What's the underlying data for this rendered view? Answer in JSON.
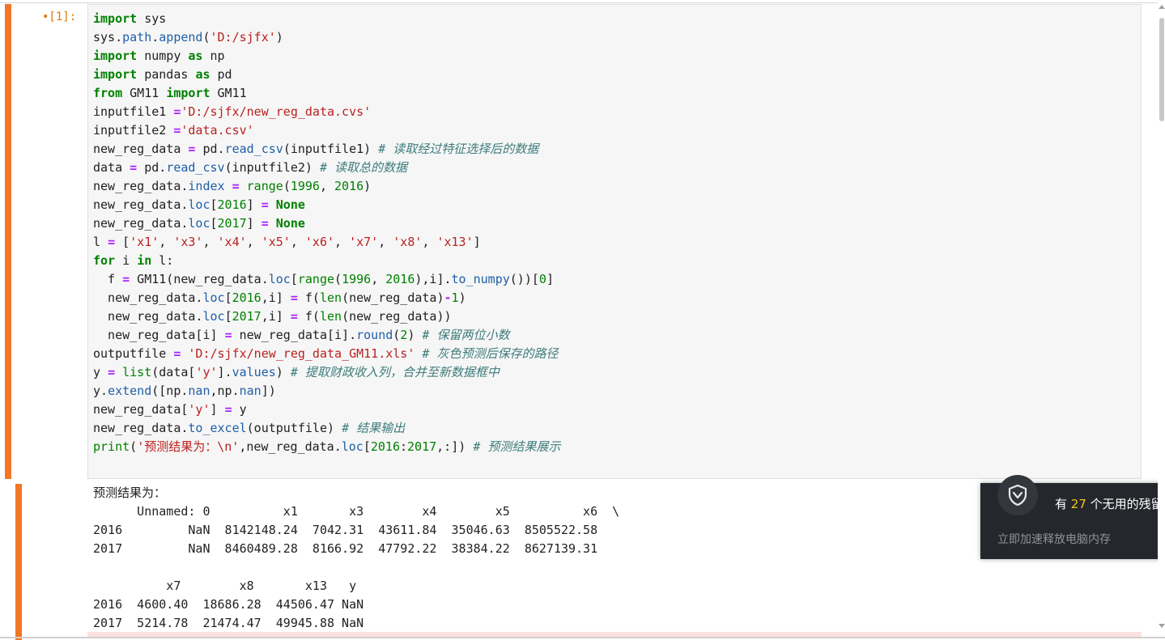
{
  "cell": {
    "prompt": "•[1]:"
  },
  "code_lines": [
    [
      [
        "kw",
        "import"
      ],
      [
        "",
        "  sys"
      ]
    ],
    [
      [
        "",
        "sys."
      ],
      [
        "attr",
        "path"
      ],
      [
        "",
        "."
      ],
      [
        "attr",
        "append"
      ],
      [
        "",
        "("
      ],
      [
        "str",
        "'D:/sjfx'"
      ],
      [
        "",
        ")"
      ]
    ],
    [
      [
        "kw",
        "import"
      ],
      [
        "",
        "  numpy "
      ],
      [
        "kw",
        "as"
      ],
      [
        "",
        "  np"
      ]
    ],
    [
      [
        "kw",
        "import"
      ],
      [
        "",
        "  pandas "
      ],
      [
        "kw",
        "as"
      ],
      [
        "",
        "  pd"
      ]
    ],
    [
      [
        "kw",
        "from"
      ],
      [
        "",
        "  GM11 "
      ],
      [
        "kw",
        "import"
      ],
      [
        "",
        "  GM11"
      ]
    ],
    [
      [
        "",
        "inputfile1 "
      ],
      [
        "op",
        "="
      ],
      [
        "str",
        "'D:/sjfx/new_reg_data.cvs'"
      ]
    ],
    [
      [
        "",
        "inputfile2 "
      ],
      [
        "op",
        "="
      ],
      [
        "str",
        "'data.csv'"
      ]
    ],
    [
      [
        "",
        "new_reg_data "
      ],
      [
        "op",
        "="
      ],
      [
        "",
        " pd."
      ],
      [
        "attr",
        "read_csv"
      ],
      [
        "",
        "(inputfile1)  "
      ],
      [
        "cm",
        "# 读取经过特征选择后的数据"
      ]
    ],
    [
      [
        "",
        "data "
      ],
      [
        "op",
        "="
      ],
      [
        "",
        " pd."
      ],
      [
        "attr",
        "read_csv"
      ],
      [
        "",
        "(inputfile2)  "
      ],
      [
        "cm",
        "# 读取总的数据"
      ]
    ],
    [
      [
        "",
        "new_reg_data."
      ],
      [
        "attr",
        "index"
      ],
      [
        "",
        " "
      ],
      [
        "op",
        "="
      ],
      [
        "",
        " "
      ],
      [
        "bi",
        "range"
      ],
      [
        "",
        "("
      ],
      [
        "num",
        "1996"
      ],
      [
        "",
        ", "
      ],
      [
        "num",
        "2016"
      ],
      [
        "",
        ")"
      ]
    ],
    [
      [
        "",
        "new_reg_data."
      ],
      [
        "attr",
        "loc"
      ],
      [
        "",
        "["
      ],
      [
        "num",
        "2016"
      ],
      [
        "",
        "] "
      ],
      [
        "op",
        "="
      ],
      [
        "",
        " "
      ],
      [
        "kw",
        "None"
      ]
    ],
    [
      [
        "",
        "new_reg_data."
      ],
      [
        "attr",
        "loc"
      ],
      [
        "",
        "["
      ],
      [
        "num",
        "2017"
      ],
      [
        "",
        "] "
      ],
      [
        "op",
        "="
      ],
      [
        "",
        " "
      ],
      [
        "kw",
        "None"
      ]
    ],
    [
      [
        "",
        "l "
      ],
      [
        "op",
        "="
      ],
      [
        "",
        " ["
      ],
      [
        "str",
        "'x1'"
      ],
      [
        "",
        ", "
      ],
      [
        "str",
        "'x3'"
      ],
      [
        "",
        ", "
      ],
      [
        "str",
        "'x4'"
      ],
      [
        "",
        ", "
      ],
      [
        "str",
        "'x5'"
      ],
      [
        "",
        ", "
      ],
      [
        "str",
        "'x6'"
      ],
      [
        "",
        ", "
      ],
      [
        "str",
        "'x7'"
      ],
      [
        "",
        ", "
      ],
      [
        "str",
        "'x8'"
      ],
      [
        "",
        ", "
      ],
      [
        "str",
        "'x13'"
      ],
      [
        "",
        "]"
      ]
    ],
    [
      [
        "kw",
        "for"
      ],
      [
        "",
        " i "
      ],
      [
        "kw",
        "in"
      ],
      [
        "",
        " l:"
      ]
    ],
    [
      [
        "",
        "    f "
      ],
      [
        "op",
        "="
      ],
      [
        "",
        " GM11(new_reg_data."
      ],
      [
        "attr",
        "loc"
      ],
      [
        "",
        "["
      ],
      [
        "bi",
        "range"
      ],
      [
        "",
        "("
      ],
      [
        "num",
        "1996"
      ],
      [
        "",
        ", "
      ],
      [
        "num",
        "2016"
      ],
      [
        "",
        "),i]."
      ],
      [
        "attr",
        "to_numpy"
      ],
      [
        "",
        "())["
      ],
      [
        "num",
        "0"
      ],
      [
        "",
        "]"
      ]
    ],
    [
      [
        "",
        "    new_reg_data."
      ],
      [
        "attr",
        "loc"
      ],
      [
        "",
        "["
      ],
      [
        "num",
        "2016"
      ],
      [
        "",
        ",i] "
      ],
      [
        "op",
        "="
      ],
      [
        "",
        " f("
      ],
      [
        "bi",
        "len"
      ],
      [
        "",
        "(new_reg_data)"
      ],
      [
        "op",
        "-"
      ],
      [
        "num",
        "1"
      ],
      [
        "",
        ")"
      ]
    ],
    [
      [
        "",
        "    new_reg_data."
      ],
      [
        "attr",
        "loc"
      ],
      [
        "",
        "["
      ],
      [
        "num",
        "2017"
      ],
      [
        "",
        ",i] "
      ],
      [
        "op",
        "="
      ],
      [
        "",
        " f("
      ],
      [
        "bi",
        "len"
      ],
      [
        "",
        "(new_reg_data))"
      ]
    ],
    [
      [
        "",
        "    new_reg_data[i] "
      ],
      [
        "op",
        "="
      ],
      [
        "",
        " new_reg_data[i]."
      ],
      [
        "attr",
        "round"
      ],
      [
        "",
        "("
      ],
      [
        "num",
        "2"
      ],
      [
        "",
        ")  "
      ],
      [
        "cm",
        "# 保留两位小数"
      ]
    ],
    [
      [
        "",
        "outputfile "
      ],
      [
        "op",
        "="
      ],
      [
        "",
        " "
      ],
      [
        "str",
        "'D:/sjfx/new_reg_data_GM11.xls'"
      ],
      [
        "",
        "  "
      ],
      [
        "cm",
        "# 灰色预测后保存的路径"
      ]
    ],
    [
      [
        "",
        "y "
      ],
      [
        "op",
        "="
      ],
      [
        "",
        " "
      ],
      [
        "bi",
        "list"
      ],
      [
        "",
        "(data["
      ],
      [
        "str",
        "'y'"
      ],
      [
        "",
        "]."
      ],
      [
        "attr",
        "values"
      ],
      [
        "",
        ")  "
      ],
      [
        "cm",
        "# 提取财政收入列，合并至新数据框中"
      ]
    ],
    [
      [
        "",
        "y."
      ],
      [
        "attr",
        "extend"
      ],
      [
        "",
        "([np."
      ],
      [
        "attr",
        "nan"
      ],
      [
        "",
        ",np."
      ],
      [
        "attr",
        "nan"
      ],
      [
        "",
        "])"
      ]
    ],
    [
      [
        "",
        "new_reg_data["
      ],
      [
        "str",
        "'y'"
      ],
      [
        "",
        "] "
      ],
      [
        "op",
        "="
      ],
      [
        "",
        " y"
      ]
    ],
    [
      [
        "",
        "new_reg_data."
      ],
      [
        "attr",
        "to_excel"
      ],
      [
        "",
        "(outputfile)  "
      ],
      [
        "cm",
        "# 结果输出"
      ]
    ],
    [
      [
        "bi",
        "print"
      ],
      [
        "",
        "("
      ],
      [
        "str",
        "'预测结果为：\\n'"
      ],
      [
        "",
        ",new_reg_data."
      ],
      [
        "attr",
        "loc"
      ],
      [
        "",
        "["
      ],
      [
        "num",
        "2016"
      ],
      [
        "",
        ":"
      ],
      [
        "num",
        "2017"
      ],
      [
        "",
        ",:])  "
      ],
      [
        "cm",
        "# 预测结果展示"
      ]
    ]
  ],
  "output_lines": [
    "预测结果为：",
    "      Unnamed: 0          x1       x3        x4        x5          x6  \\",
    "2016         NaN  8142148.24  7042.31  43611.84  35046.63  8505522.58",
    "2017         NaN  8460489.28  8166.92  47792.22  38384.22  8627139.31",
    "",
    "          x7        x8       x13   y",
    "2016  4600.40  18686.28  44506.47 NaN",
    "2017  5214.78  21474.47  49945.88 NaN"
  ],
  "toast": {
    "prefix": "有",
    "count": "27",
    "suffix": "个无用的残留",
    "subtitle": "立即加速释放电脑内存",
    "icon": "shield-check-icon"
  },
  "colors": {
    "cell_bar": "#f37626",
    "prompt": "#e0770a",
    "keyword": "#008000",
    "string": "#ba2121",
    "comment": "#3d7b7b",
    "toast_bg": "#24272c",
    "toast_count": "#f5c518"
  }
}
